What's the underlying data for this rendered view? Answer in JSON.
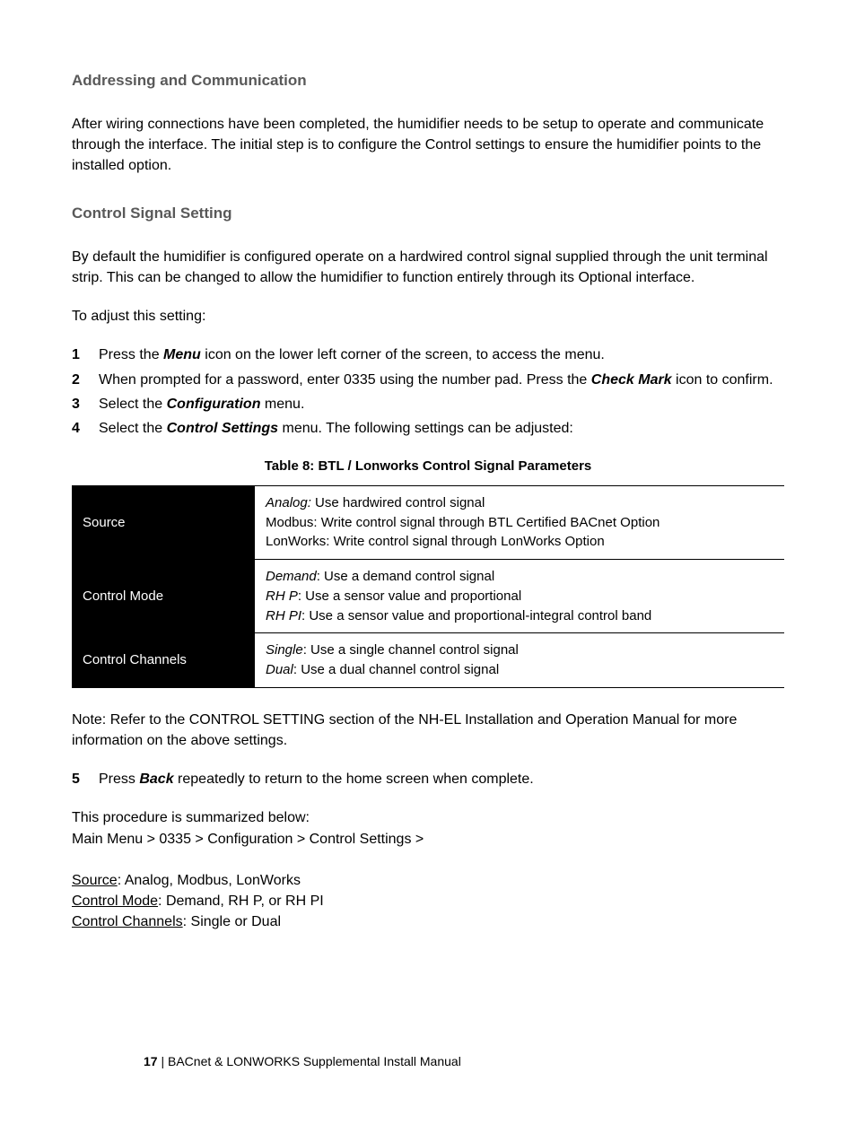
{
  "h1": "Addressing and Communication",
  "p1": "After wiring connections have been completed, the humidifier needs to be setup to operate and communicate through the interface.  The initial step is to configure the Control settings to ensure the humidifier points to the installed option.",
  "h2": "Control Signal Setting",
  "p2": "By default the humidifier is configured operate on a hardwired control signal supplied through the unit terminal strip.  This can be changed to allow the humidifier to function entirely through its Optional interface.",
  "p3": "To adjust this setting:",
  "step1_a": "Press the ",
  "step1_bi": "Menu",
  "step1_b": " icon on the lower left corner of the screen, to access the menu.",
  "step2_a": "When prompted for a password, enter 0335 using the number pad. Press the ",
  "step2_bi": "Check Mark",
  "step2_b": " icon to confirm.",
  "step3_a": "Select the ",
  "step3_bi": "Configuration",
  "step3_b": " menu.",
  "step4_a": "Select the ",
  "step4_bi": "Control Settings",
  "step4_b": " menu.  The following settings can be adjusted:",
  "table_caption": "Table 8: BTL / Lonworks Control Signal Parameters",
  "row1_h": "Source",
  "row1_l1a": "Analog:",
  "row1_l1b": "  Use hardwired control signal",
  "row1_l2": "Modbus: Write control signal through BTL Certified BACnet Option",
  "row1_l3": "LonWorks: Write control signal through LonWorks Option",
  "row2_h": "Control Mode",
  "row2_l1a": "Demand",
  "row2_l1b": ": Use a demand control signal",
  "row2_l2a": "RH P",
  "row2_l2b": ": Use a sensor value and proportional",
  "row2_l3a": "RH PI",
  "row2_l3b": ": Use a sensor value and proportional-integral control band",
  "row3_h": "Control Channels",
  "row3_l1a": "Single",
  "row3_l1b": ": Use a single channel control signal",
  "row3_l2a": "Dual",
  "row3_l2b": ": Use a dual channel control signal",
  "note": "Note: Refer to the CONTROL SETTING section of the NH-EL Installation and Operation Manual for more information on the above settings.",
  "step5_n": "5",
  "step5_a": "Press ",
  "step5_bi": "Back",
  "step5_b": " repeatedly to return to the home screen when complete.",
  "summary1": "This procedure is summarized below:",
  "summary2": "Main Menu > 0335 > Configuration > Control Settings >",
  "s_src_u": "Source",
  "s_src_t": ": Analog, Modbus, LonWorks",
  "s_cm_u": "Control Mode",
  "s_cm_t": ": Demand, RH P, or RH PI",
  "s_cc_u": "Control Channels",
  "s_cc_t": ": Single or Dual",
  "page_num": "17",
  "footer_sep": " | ",
  "footer_text": "BACnet & LONWORKS Supplemental Install Manual"
}
